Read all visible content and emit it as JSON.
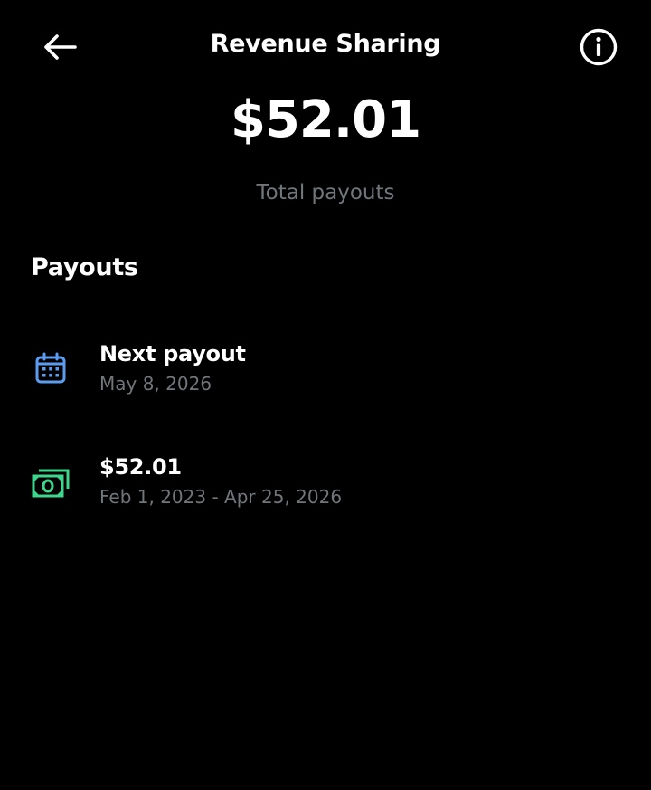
{
  "header": {
    "back_icon": "arrow-left-icon",
    "title": "Revenue Sharing",
    "info_icon": "info-circle-icon"
  },
  "summary": {
    "amount": "$52.01",
    "label": "Total payouts"
  },
  "payouts": {
    "section_title": "Payouts",
    "items": [
      {
        "icon": "calendar-icon",
        "icon_color": "#5b9bf0",
        "title": "Next payout",
        "subtitle": "May 8, 2026"
      },
      {
        "icon": "money-icon",
        "icon_color": "#3dd68c",
        "title": "$52.01",
        "subtitle": "Feb 1, 2023 - Apr 25, 2026"
      }
    ]
  },
  "colors": {
    "background": "#000000",
    "primary_text": "#ffffff",
    "secondary_text": "#71767b"
  }
}
